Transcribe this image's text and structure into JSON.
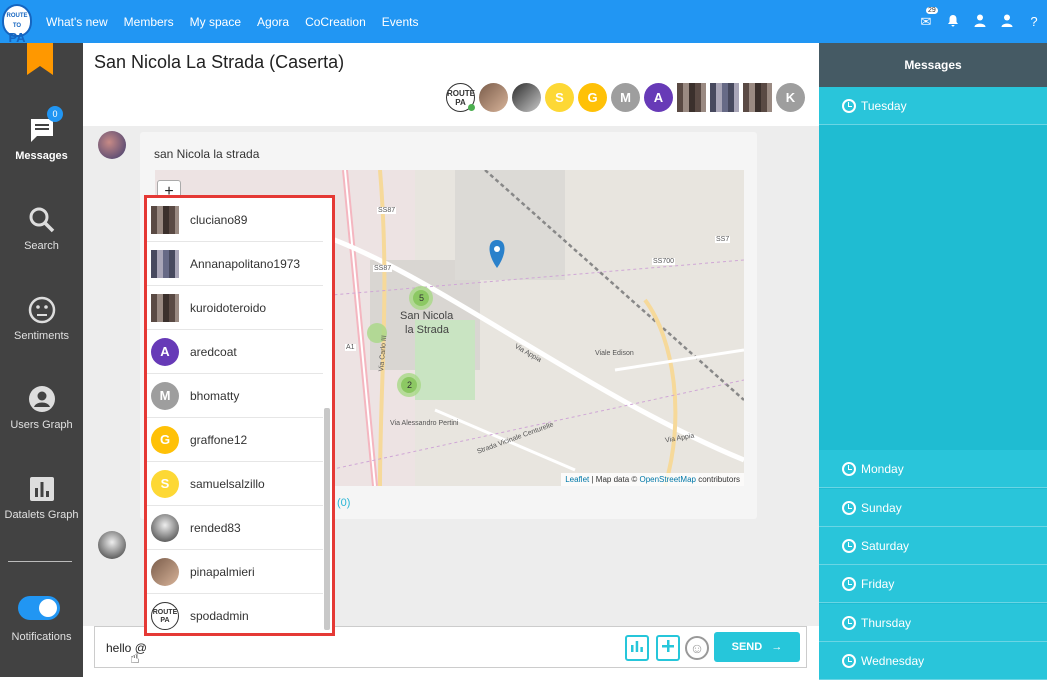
{
  "topbar": {
    "logo_top": "ROUTE TO",
    "logo_main": "PA",
    "nav": [
      "What's new",
      "Members",
      "My space",
      "Agora",
      "CoCreation",
      "Events"
    ],
    "mail_badge": "29",
    "help_label": "?"
  },
  "sidebar": {
    "items": [
      {
        "label": "Messages",
        "badge": "0"
      },
      {
        "label": "Search"
      },
      {
        "label": "Sentiments"
      },
      {
        "label": "Users Graph"
      },
      {
        "label": "Datalets Graph"
      },
      {
        "label": "Notifications"
      }
    ]
  },
  "room": {
    "title": "San Nicola La Strada (Caserta)",
    "members": [
      {
        "type": "logo"
      },
      {
        "type": "photo"
      },
      {
        "type": "photo2"
      },
      {
        "letter": "S",
        "color": "#fdd835"
      },
      {
        "letter": "G",
        "color": "#ffc107"
      },
      {
        "letter": "M",
        "color": "#9e9e9e"
      },
      {
        "letter": "A",
        "color": "#673ab7"
      },
      {
        "type": "pix"
      },
      {
        "type": "pix2"
      },
      {
        "type": "pix"
      },
      {
        "letter": "K",
        "color": "#9e9e9e"
      }
    ]
  },
  "message": {
    "text": "san Nicola la strada",
    "map": {
      "zoom_in": "+",
      "place_line1": "San Nicola",
      "place_line2": "la Strada",
      "cluster_a": "5",
      "cluster_b": "2",
      "roads": [
        "SS87",
        "SS87",
        "SS7",
        "SS700",
        "A1",
        "Via Appia",
        "Viale Edison",
        "Via Appia",
        "Via Alessandro Pertini",
        "Strada Vicinale Centurelle",
        "Via Carlo III"
      ],
      "attribution_leaflet": "Leaflet",
      "attribution_mid": " | Map data © ",
      "attribution_osm": "OpenStreetMap",
      "attribution_end": " contributors"
    },
    "count_link": "(0)"
  },
  "mention_dropdown": {
    "users": [
      {
        "name": "cluciano89",
        "avatar": "pix"
      },
      {
        "name": "Annanapolitano1973",
        "avatar": "pix2"
      },
      {
        "name": "kuroidoteroido",
        "avatar": "pix"
      },
      {
        "name": "aredcoat",
        "letter": "A",
        "color": "#673ab7"
      },
      {
        "name": "bhomatty",
        "letter": "M",
        "color": "#9e9e9e"
      },
      {
        "name": "graffone12",
        "letter": "G",
        "color": "#ffc107"
      },
      {
        "name": "samuelsalzillo",
        "letter": "S",
        "color": "#fdd835"
      },
      {
        "name": "rended83",
        "avatar": "photo2"
      },
      {
        "name": "pinapalmieri",
        "avatar": "photo"
      },
      {
        "name": "spodadmin",
        "avatar": "logo"
      }
    ]
  },
  "compose": {
    "value": "hello @",
    "send_label": "SEND"
  },
  "right_panel": {
    "title": "Messages",
    "days": [
      "Tuesday",
      "Monday",
      "Sunday",
      "Saturday",
      "Friday",
      "Thursday",
      "Wednesday"
    ]
  }
}
